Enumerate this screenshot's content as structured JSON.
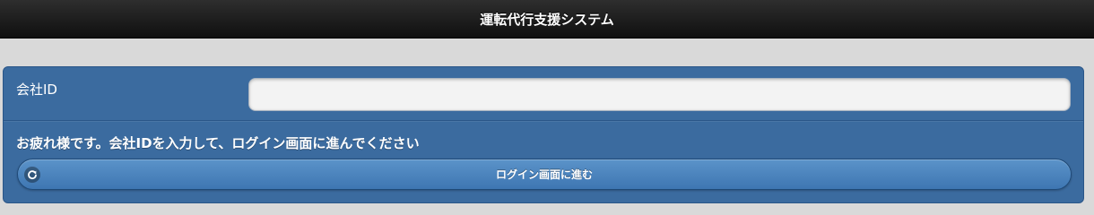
{
  "header": {
    "title": "運転代行支援システム"
  },
  "form": {
    "company_id_label": "会社ID",
    "company_id_value": "",
    "company_id_placeholder": "",
    "message": "お疲れ様です。会社IDを入力して、ログイン画面に進んでください",
    "submit_label": "ログイン画面に進む",
    "submit_icon": "arrow-cycle-icon"
  },
  "colors": {
    "header_bg": "#1a1a1a",
    "panel_bg": "#3b6b9f",
    "button_bg": "#4a84be",
    "page_bg": "#d9d9d9"
  }
}
